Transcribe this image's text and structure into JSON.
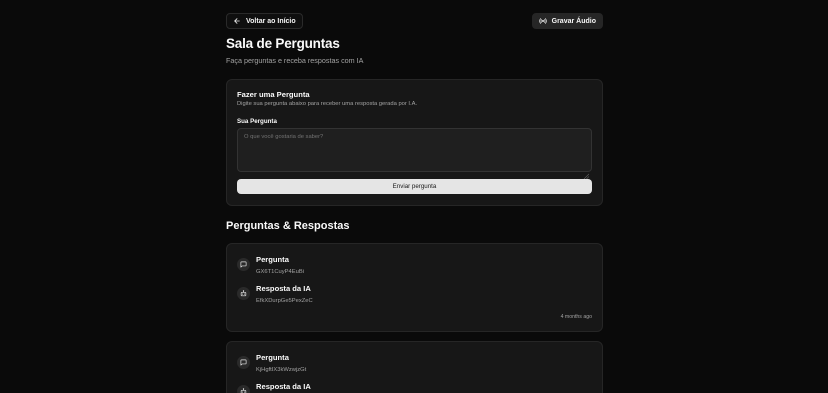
{
  "header": {
    "back_label": "Voltar ao Início",
    "audio_label": "Gravar Áudio",
    "title": "Sala de Perguntas",
    "subtitle": "Faça perguntas e receba respostas com IA"
  },
  "ask": {
    "title": "Fazer uma Pergunta",
    "description": "Digite sua pergunta abaixo para receber uma resposta gerada por I.A.",
    "field_label": "Sua Pergunta",
    "placeholder": "O que você gostaria de saber?",
    "submit_label": "Enviar pergunta"
  },
  "qa": {
    "section_title": "Perguntas & Respostas",
    "items": [
      {
        "question_label": "Pergunta",
        "question": "GX6T1CuyP4EuBi",
        "answer_label": "Resposta da IA",
        "answer": "EfkXDurpGe5PexZeC",
        "time": "4 months ago"
      },
      {
        "question_label": "Pergunta",
        "question": "KjHgftIX3kWzwjzGt",
        "answer_label": "Resposta da IA"
      }
    ]
  },
  "icons": {
    "back": "arrow-left-icon",
    "audio": "radio-icon",
    "question": "message-square-icon",
    "answer": "bot-icon"
  },
  "colors": {
    "background": "#0a0a0a",
    "card": "#171717",
    "border": "#262626",
    "muted_text": "#a3a3a3",
    "primary_button": "#e5e5e5"
  }
}
